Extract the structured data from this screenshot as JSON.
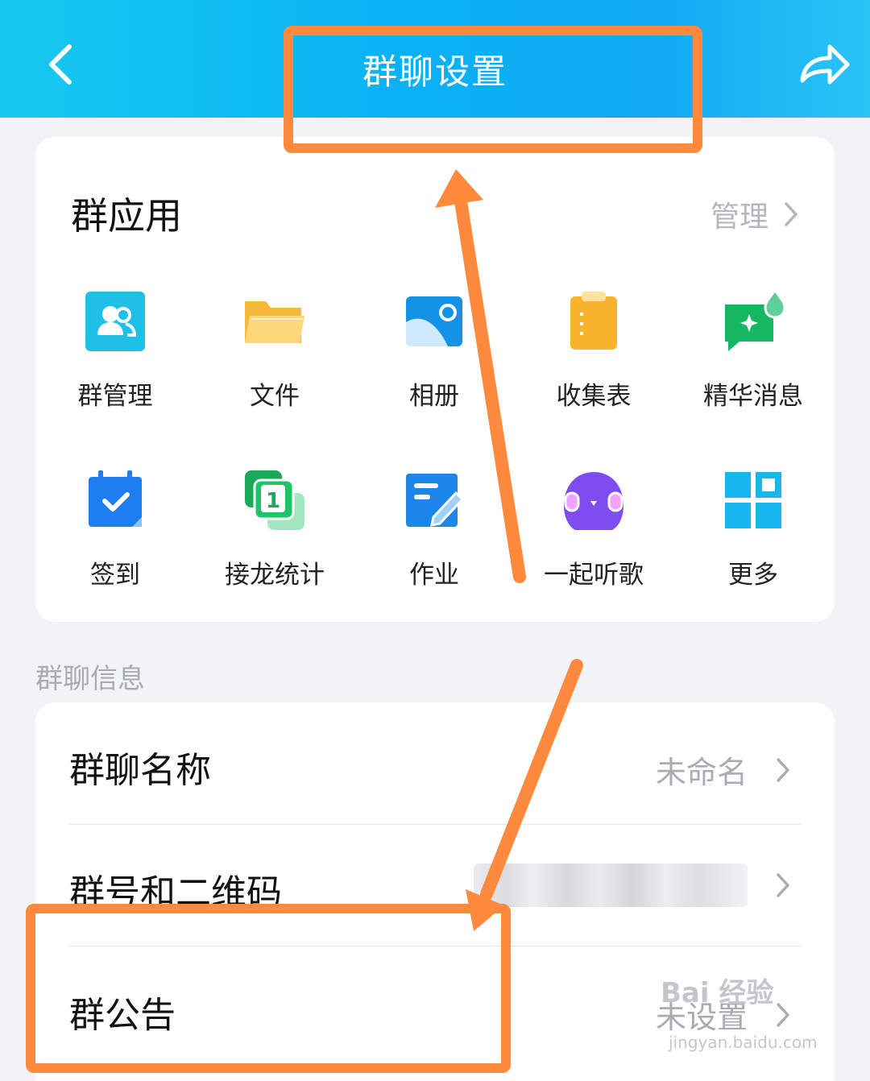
{
  "header": {
    "title": "群聊设置",
    "back_icon": "chevron-left-icon",
    "share_icon": "share-arrow-icon"
  },
  "apps": {
    "title": "群应用",
    "manage_label": "管理",
    "items": [
      {
        "label": "群管理",
        "icon": "group-manage-icon"
      },
      {
        "label": "文件",
        "icon": "folder-icon"
      },
      {
        "label": "相册",
        "icon": "photo-album-icon"
      },
      {
        "label": "收集表",
        "icon": "clipboard-icon"
      },
      {
        "label": "精华消息",
        "icon": "highlight-message-icon"
      },
      {
        "label": "签到",
        "icon": "calendar-check-icon"
      },
      {
        "label": "接龙统计",
        "icon": "relay-count-icon"
      },
      {
        "label": "作业",
        "icon": "homework-icon"
      },
      {
        "label": "一起听歌",
        "icon": "listen-together-icon"
      },
      {
        "label": "更多",
        "icon": "more-grid-icon"
      }
    ]
  },
  "info": {
    "section_label": "群聊信息",
    "rows": [
      {
        "label": "群聊名称",
        "value": "未命名"
      },
      {
        "label": "群号和二维码",
        "value": ""
      },
      {
        "label": "群公告",
        "value": "未设置"
      }
    ]
  },
  "watermark": {
    "text": "Bai 经验",
    "sub": "jingyan.baidu.com"
  },
  "colors": {
    "header_gradient_start": "#17c9f0",
    "header_gradient_end": "#10a9f4",
    "annotation_orange": "#ff8a3d"
  }
}
